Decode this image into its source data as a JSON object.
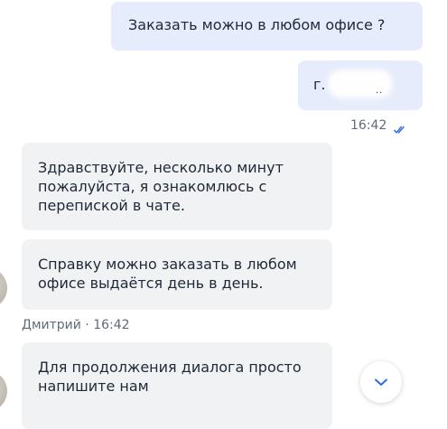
{
  "messages": {
    "outgoing": [
      {
        "text": "Заказать можно в любом офисе ?"
      },
      {
        "text": "г."
      }
    ],
    "outgoing_meta": {
      "time": "16:42",
      "status_icon": "double-check-icon"
    },
    "incoming": [
      {
        "text": "Здравствуйте, несколько минут пожалуйста, я ознакомлюсь с перепиской в чате."
      },
      {
        "text": "Справку можно заказать в любом офисе выдаётся день в день."
      },
      {
        "text": "Для продолжения диалога просто напишите нам"
      }
    ],
    "incoming_meta": {
      "author_line": "Дмитрий · 16:42"
    }
  },
  "controls": {
    "scroll_down_icon": "chevron-down-icon"
  },
  "colors": {
    "outgoing_bubble": "#e6ecfb",
    "incoming_bubble": "#f1f2f4",
    "accent": "#2f6bdc"
  }
}
